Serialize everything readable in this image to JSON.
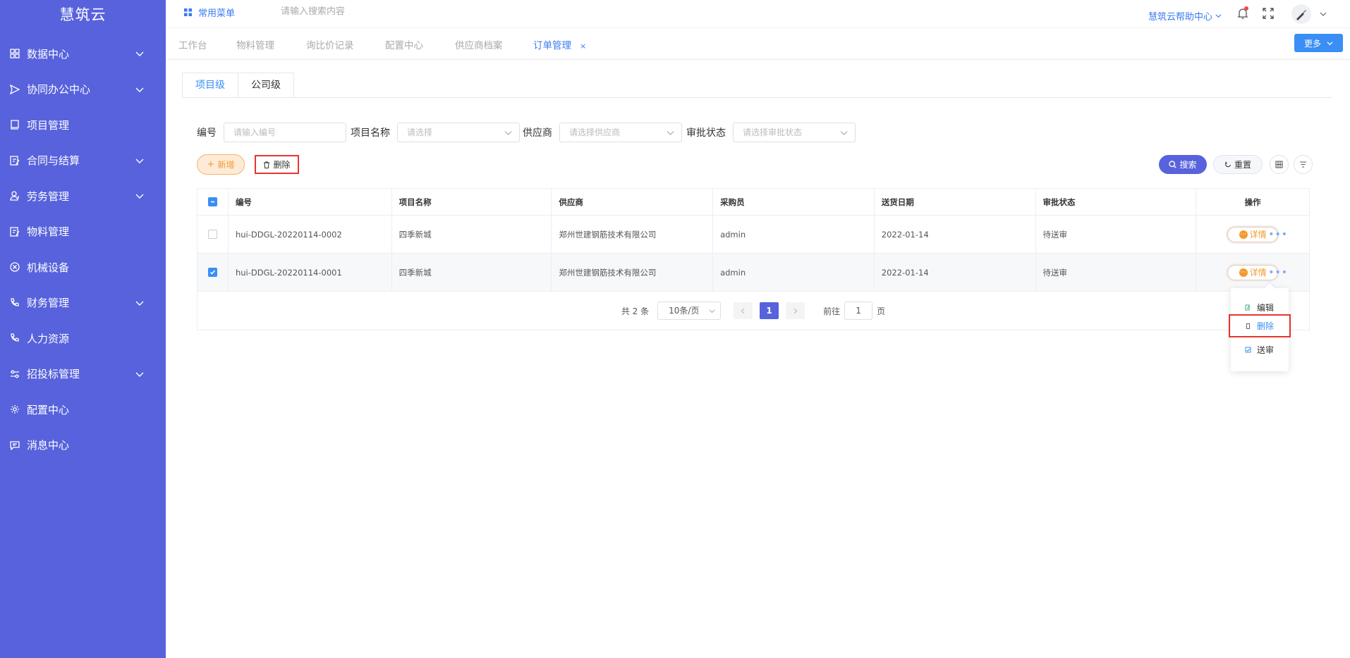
{
  "app": {
    "brand": "慧筑云"
  },
  "sidebar": {
    "items": [
      {
        "label": "数据中心",
        "icon": "grid-icon",
        "expandable": true
      },
      {
        "label": "协同办公中心",
        "icon": "send-icon",
        "expandable": true
      },
      {
        "label": "项目管理",
        "icon": "book-icon",
        "expandable": false
      },
      {
        "label": "合同与结算",
        "icon": "edit-doc-icon",
        "expandable": true
      },
      {
        "label": "劳务管理",
        "icon": "user-icon",
        "expandable": true
      },
      {
        "label": "物料管理",
        "icon": "edit-doc-icon",
        "expandable": false
      },
      {
        "label": "机械设备",
        "icon": "x-circle-icon",
        "expandable": false
      },
      {
        "label": "财务管理",
        "icon": "phone-icon",
        "expandable": true
      },
      {
        "label": "人力资源",
        "icon": "phone-icon",
        "expandable": false
      },
      {
        "label": "招投标管理",
        "icon": "sliders-icon",
        "expandable": true
      },
      {
        "label": "配置中心",
        "icon": "gear-icon",
        "expandable": false
      },
      {
        "label": "消息中心",
        "icon": "message-icon",
        "expandable": false
      }
    ]
  },
  "topbar": {
    "common_menu": "常用菜单",
    "search_placeholder": "请输入搜索内容",
    "help": "慧筑云帮助中心"
  },
  "tabs": [
    {
      "label": "工作台",
      "active": false
    },
    {
      "label": "物料管理",
      "active": false
    },
    {
      "label": "询比价记录",
      "active": false
    },
    {
      "label": "配置中心",
      "active": false
    },
    {
      "label": "供应商档案",
      "active": false
    },
    {
      "label": "订单管理",
      "active": true,
      "closable": true
    }
  ],
  "tab_close": "×",
  "more_label": "更多",
  "level_tabs": [
    {
      "label": "项目级",
      "active": true
    },
    {
      "label": "公司级",
      "active": false
    }
  ],
  "filters": {
    "code_label": "编号",
    "code_placeholder": "请输入编号",
    "project_label": "项目名称",
    "project_placeholder": "请选择",
    "supplier_label": "供应商",
    "supplier_placeholder": "请选择供应商",
    "status_label": "审批状态",
    "status_placeholder": "请选择审批状态"
  },
  "toolbar": {
    "add": "新增",
    "delete": "删除",
    "search": "搜索",
    "reset": "重置"
  },
  "table": {
    "headers": [
      "编号",
      "项目名称",
      "供应商",
      "采购员",
      "送货日期",
      "审批状态",
      "操作"
    ],
    "rows": [
      {
        "checked": false,
        "code": "hui-DDGL-20220114-0002",
        "project": "四季新城",
        "supplier": "郑州世建钢筋技术有限公司",
        "buyer": "admin",
        "date": "2022-01-14",
        "status": "待送审"
      },
      {
        "checked": true,
        "code": "hui-DDGL-20220114-0001",
        "project": "四季新城",
        "supplier": "郑州世建钢筋技术有限公司",
        "buyer": "admin",
        "date": "2022-01-14",
        "status": "待送审"
      }
    ],
    "detail_label": "详情",
    "more_dots": "•••"
  },
  "pagination": {
    "total": "共 2 条",
    "page_size": "10条/页",
    "current": "1",
    "goto_prefix": "前往",
    "goto_value": "1",
    "goto_suffix": "页"
  },
  "popup": {
    "items": [
      {
        "label": "编辑",
        "highlight": false
      },
      {
        "label": "删除",
        "highlight": true
      },
      {
        "label": "送审",
        "highlight": false
      }
    ]
  },
  "colors": {
    "sidebar": "#5762dc",
    "accent": "#3a8ef6",
    "warning": "#f39a2e",
    "highlight_border": "#e5362f"
  }
}
